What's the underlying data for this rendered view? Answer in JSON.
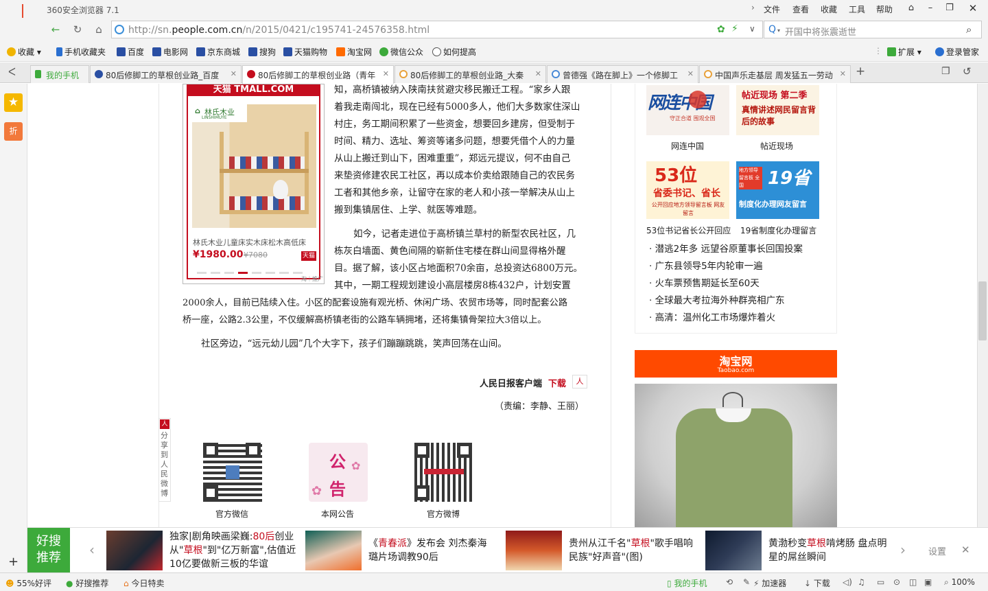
{
  "window": {
    "title": "360安全浏览器 7.1",
    "menu": [
      "文件",
      "查看",
      "收藏",
      "工具",
      "帮助"
    ]
  },
  "address": {
    "url_prefix": "http://sn.",
    "url_domain": "people.com.cn",
    "url_path": "/n/2015/0421/c195741-24576358.html",
    "search_placeholder": "开国中将张震逝世"
  },
  "bookmarks": {
    "items": [
      "收藏",
      "手机收藏夹",
      "百度",
      "电影网",
      "京东商城",
      "搜狗",
      "天猫购物",
      "淘宝网",
      "微信公众",
      "如何提高"
    ],
    "right": [
      "扩展",
      "登录管家"
    ]
  },
  "tabs": [
    {
      "label": "我的手机"
    },
    {
      "label": "80后修脚工的草根创业路_百度"
    },
    {
      "label": "80后修脚工的草根创业路（青年"
    },
    {
      "label": "80后修脚工的草根创业路_大秦"
    },
    {
      "label": "曾德强《路在脚上》一个修脚工"
    },
    {
      "label": "中国声乐走基层 周发猛五一劳动"
    }
  ],
  "leftstrip": {
    "badge": "折"
  },
  "ad": {
    "brand": "天猫 TMALL.COM",
    "logo": "林氏木业",
    "logo_sub": "LINSHIMUYE",
    "product": "林氏木业儿童床实木床松木高低床",
    "price": "¥1980.00",
    "old_price": "¥7080",
    "tag": "天猫",
    "source": "淘｜推广"
  },
  "article": {
    "p1_lines": [
      "知，高桥镇被纳入陕南扶贫避灾移民搬迁工程。“家乡人跟",
      "着我走南闯北，现在已经有5000多人，他们大多数家住深山",
      "村庄，务工期间积累了一些资金，想要回乡建房，但受制于",
      "时间、精力、选址、筹资等诸多问题，想要凭借个人的力量",
      "从山上搬迁到山下，困难重重”，郑远元提议，何不由自己",
      "来垫资修建农民工社区，再以成本价卖给跟随自己的农民务",
      "工者和其他乡亲，让留守在家的老人和小孩一举解决从山上",
      "搬到集镇居住、上学、就医等难题。"
    ],
    "p2_lines": [
      "如今，记者走进位于高桥镇兰草村的新型农民社区，几",
      "栋灰白墙面、黄色间隔的崭新住宅楼在群山间显得格外醒",
      "目。据了解，该小区占地面积70余亩，总投资达6800万元。",
      "其中，一期工程规划建设小高层楼房8栋432户，计划安置"
    ],
    "p2_full_lines": [
      "2000余人，目前已陆续入住。小区的配套设施有观光桥、休闲广场、农贸市场等，同时配套公路",
      "桥一座，公路2.3公里，不仅缓解高桥镇老街的公路车辆拥堵，还将集镇骨架拉大3倍以上。"
    ],
    "p3": "社区旁边，“远元幼儿园”几个大字下，孩子们蹦蹦跳跳，笑声回荡在山间。",
    "app_label": "人民日报客户端",
    "download": "下载",
    "editor": "（责编：李静、王丽）",
    "share_label": "分享到人民微博",
    "qr_items": [
      "官方微信",
      "本网公告",
      "官方微博"
    ],
    "notice_chars": [
      "公",
      "告"
    ]
  },
  "sidebar": {
    "promo": [
      {
        "title": "网连中国",
        "img_text": "网连中国",
        "img_sub": "守正合道 围观全国"
      },
      {
        "title": "帖近现场",
        "img_text": "帖近现场 第二季",
        "img_sub": "真情讲述网民留言背后的故事"
      },
      {
        "title": "53位书记省长公开回应",
        "img_text": "53位",
        "img_sub": "省委书记、省长",
        "img_sub2": "公开回应地方领导留言板 网友留言"
      },
      {
        "title": "19省制度化办理留言",
        "img_text": "19省",
        "img_sub": "制度化办理网友留言",
        "img_tag": "地方领导留言板 全国"
      }
    ],
    "news": [
      "潜逃2年多 远望谷原董事长回国投案",
      "广东县领导5年内轮审一遍",
      "火车票预售期延长至60天",
      "全球最大考拉海外种群亮相广东",
      "高清：温州化工市场爆炸着火"
    ],
    "taobao_label": "淘宝网",
    "taobao_sub": "Taobao.com"
  },
  "newsbar": {
    "label_line1": "好搜",
    "label_line2": "推荐",
    "items": [
      {
        "pre": "独家|剧角映画梁巍:",
        "hl": "80后",
        "post": "创业从\"",
        "hl2": "草根",
        "post2": "\"到\"亿万新富\",估值近10亿要做新三板的华谊"
      },
      {
        "pre": "《",
        "hl": "青春派",
        "post": "》发布会 刘杰秦海璐片场调教90后",
        "hl2": "",
        "post2": ""
      },
      {
        "pre": "贵州从江千名\"",
        "hl": "草根",
        "post": "\"歌手唱响民族\"好声音\"(图)",
        "hl2": "",
        "post2": ""
      },
      {
        "pre": "黄渤秒变",
        "hl": "草根",
        "post": "啃烤肠 盘点明星的屌丝瞬间",
        "hl2": "",
        "post2": ""
      }
    ],
    "settings": "设置"
  },
  "statusbar": {
    "left": [
      "55%好评",
      "好搜推荐",
      "今日特卖"
    ],
    "right": [
      "我的手机",
      "加速器",
      "下载",
      "100%"
    ]
  },
  "colors": {
    "accent_red": "#c40d1e",
    "green": "#3daa3b",
    "taobao": "#ff4a00"
  }
}
